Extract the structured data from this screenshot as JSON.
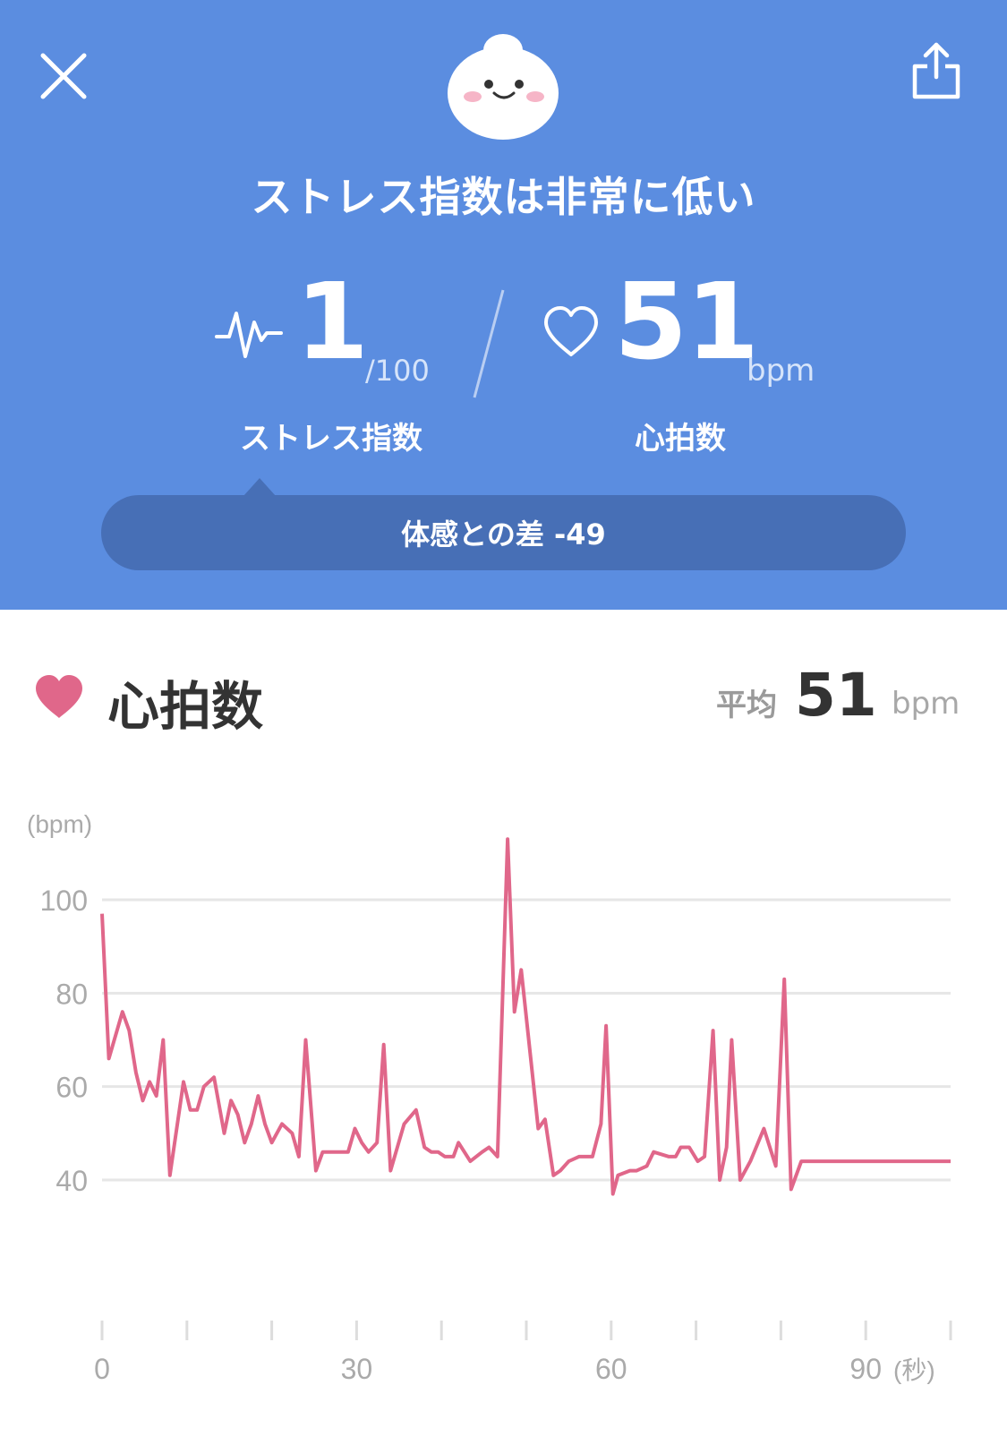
{
  "header": {
    "headline": "ストレス指数は非常に低い",
    "icons": {
      "close": "close-icon",
      "share": "share-icon",
      "mascot": "mascot-icon"
    },
    "colors": {
      "background": "#5b8de0",
      "pill": "#476fb6"
    }
  },
  "stress": {
    "value": "1",
    "max": "/100",
    "label": "ストレス指数",
    "icon": "pulse-icon"
  },
  "heart_rate": {
    "value": "51",
    "unit": "bpm",
    "label": "心拍数",
    "icon": "heart-outline-icon"
  },
  "difference": {
    "text": "体感との差 -49"
  },
  "section": {
    "title": "心拍数",
    "icon": "heart-icon",
    "avg_label": "平均",
    "avg_value": "51",
    "avg_unit": "bpm"
  },
  "chart_data": {
    "type": "line",
    "ylabel": "(bpm)",
    "xlabel": "(秒)",
    "yticks": [
      100,
      80,
      60,
      40
    ],
    "ytick_labels": [
      "100",
      "80",
      "60",
      "40"
    ],
    "xticks": [
      0,
      30,
      60,
      90
    ],
    "xtick_labels": [
      "0",
      "30",
      "60",
      "90"
    ],
    "xlim": [
      0,
      100
    ],
    "ylim": [
      25,
      110
    ],
    "grid": true,
    "color": "#e0678a",
    "series": [
      {
        "x": [
          0,
          0.8,
          1.6,
          2.4,
          3.2,
          4.0,
          4.8,
          5.6,
          6.4,
          7.2,
          8.0,
          9.6,
          10.4,
          11.2,
          12.0,
          13.2,
          14.4,
          15.2,
          16.0,
          16.8,
          17.6,
          18.4,
          19.2,
          20.0,
          21.2,
          22.4,
          23.2,
          24.0,
          25.2,
          26.0,
          26.8,
          28.0,
          29.0,
          29.8,
          30.6,
          31.4,
          32.4,
          33.2,
          34.0,
          34.8,
          35.6,
          37.0,
          38.0,
          38.8,
          39.6,
          40.4,
          41.4,
          42.0,
          43.4,
          44.8,
          45.6,
          46.6,
          47.8,
          48.6,
          49.4,
          50.4,
          51.4,
          52.2,
          53.2,
          54.0,
          55.0,
          56.2,
          57.0,
          57.8,
          58.8,
          59.4,
          60.2,
          60.8,
          62.2,
          63.0,
          64.2,
          65.0,
          66.8,
          67.6,
          68.2,
          69.2,
          70.2,
          71.0,
          72.0,
          72.8,
          73.6,
          74.2,
          75.2,
          76.4,
          78.0,
          79.4,
          80.4,
          81.2,
          82.4,
          83.6,
          84.4,
          85.6,
          86.4,
          87.2,
          88.0,
          88.8,
          89.6,
          90.4,
          91.6,
          92.4,
          93.6,
          94.6,
          95.6,
          96.6,
          97.4,
          98.2,
          99.0,
          100.0
        ],
        "y": [
          97,
          66,
          71,
          76,
          72,
          63,
          57,
          61,
          58,
          70,
          41,
          61,
          55,
          55,
          60,
          62,
          50,
          57,
          54,
          48,
          52,
          58,
          52,
          48,
          52,
          50,
          45,
          70,
          42,
          46,
          46,
          46,
          46,
          51,
          48,
          46,
          48,
          69,
          42,
          47,
          52,
          55,
          47,
          46,
          46,
          45,
          45,
          48,
          44,
          46,
          47,
          45,
          113,
          76,
          85,
          68,
          51,
          53,
          41,
          42,
          44,
          45,
          45,
          45,
          52,
          73,
          37,
          41,
          42,
          42,
          43,
          46,
          45,
          45,
          47,
          47,
          44,
          45,
          72,
          40,
          47,
          70,
          40,
          44,
          51,
          43,
          83,
          38,
          44,
          44,
          44,
          44,
          44,
          44,
          44,
          44,
          44,
          44,
          44,
          44,
          44,
          44,
          44,
          44,
          44,
          44,
          44,
          44
        ]
      }
    ]
  }
}
